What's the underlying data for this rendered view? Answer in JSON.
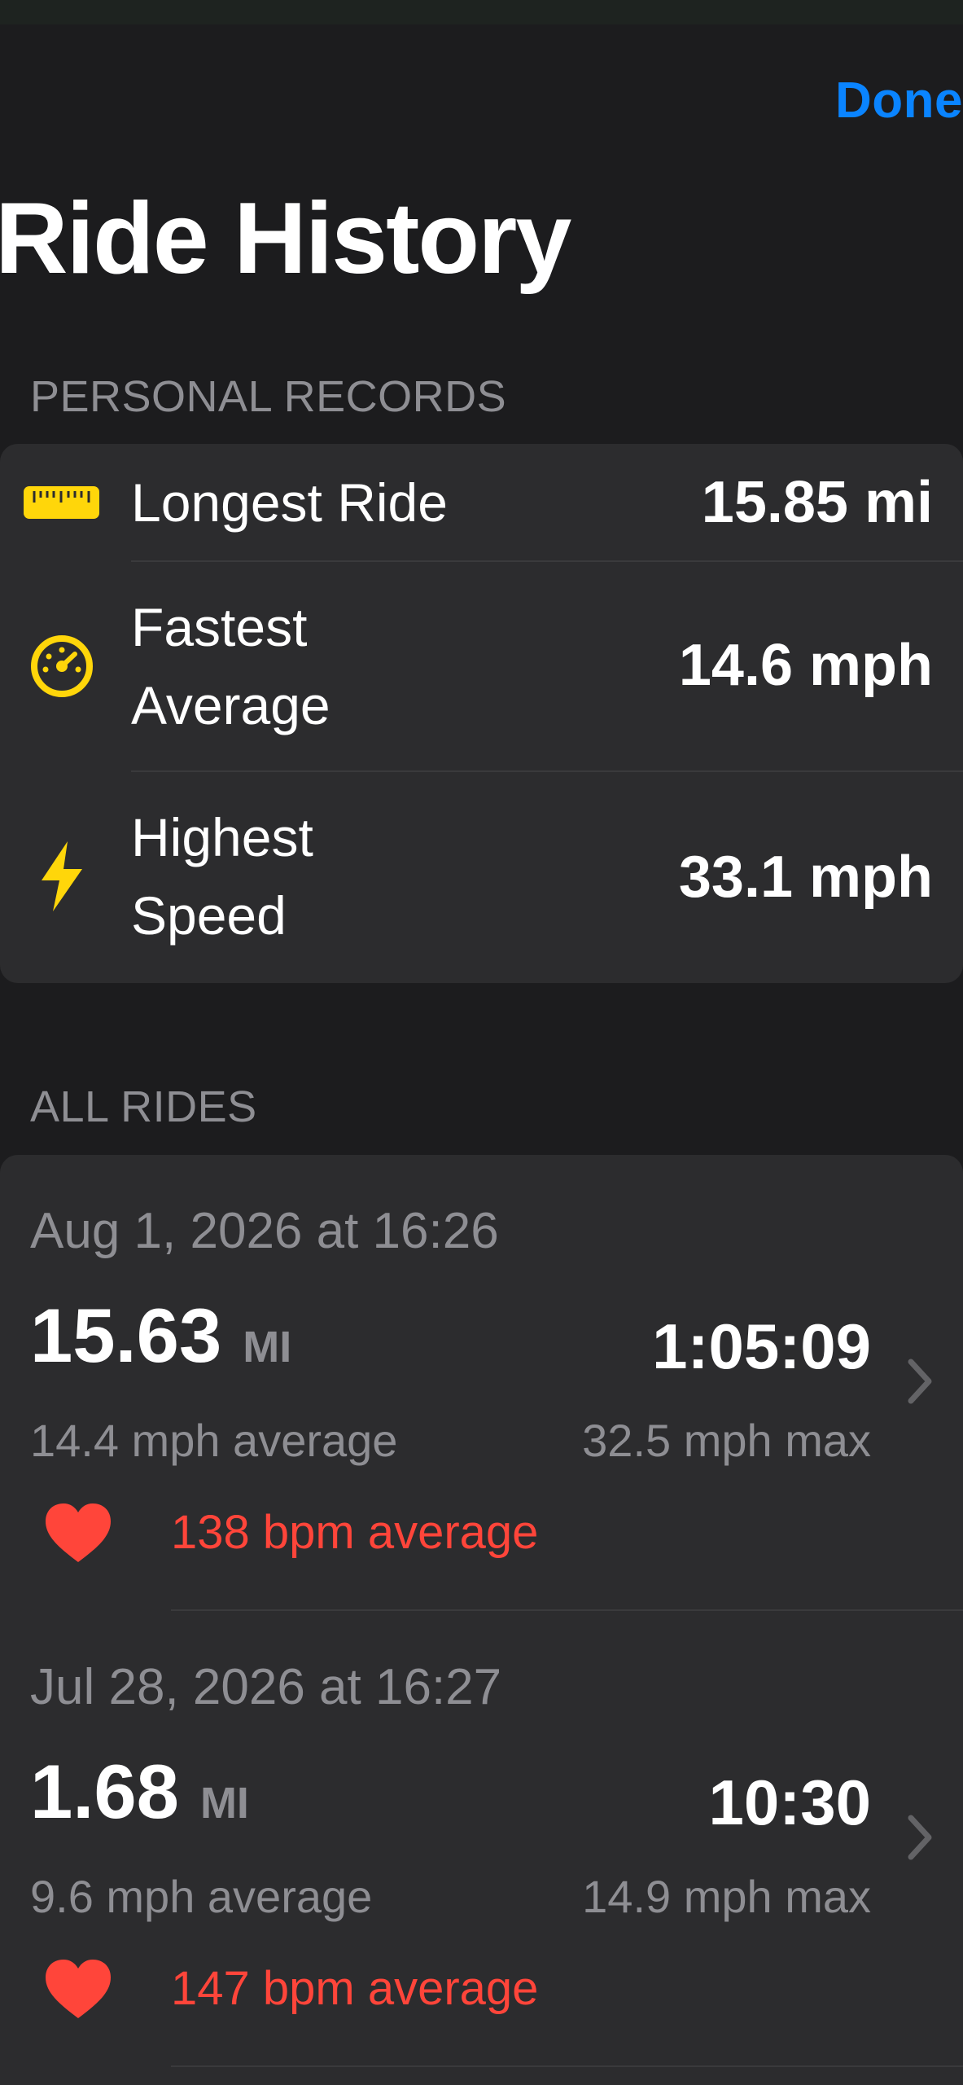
{
  "nav": {
    "done_label": "Done"
  },
  "page": {
    "title": "Ride History"
  },
  "records": {
    "header": "PERSONAL RECORDS",
    "items": [
      {
        "icon": "ruler-icon",
        "label": "Longest Ride",
        "value": "15.85 mi"
      },
      {
        "icon": "speedometer-icon",
        "label": "Fastest Average",
        "value": "14.6 mph"
      },
      {
        "icon": "bolt-icon",
        "label": "Highest Speed",
        "value": "33.1 mph"
      }
    ]
  },
  "rides": {
    "header": "ALL RIDES",
    "items": [
      {
        "date": "Aug 1, 2026 at 16:26",
        "distance": "15.63",
        "unit": "MI",
        "duration": "1:05:09",
        "avg_speed": "14.4 mph average",
        "max_speed": "32.5 mph max",
        "heart_rate": "138 bpm average"
      },
      {
        "date": "Jul 28, 2026 at 16:27",
        "distance": "1.68",
        "unit": "MI",
        "duration": "10:30",
        "avg_speed": "9.6 mph average",
        "max_speed": "14.9 mph max",
        "heart_rate": "147 bpm average"
      }
    ]
  },
  "colors": {
    "accent": "#0a84ff",
    "record_icon": "#ffd60a",
    "heart": "#ff453a",
    "background": "#1c1c1e",
    "card": "#2c2c2e",
    "secondary_text": "#8e8e93"
  }
}
